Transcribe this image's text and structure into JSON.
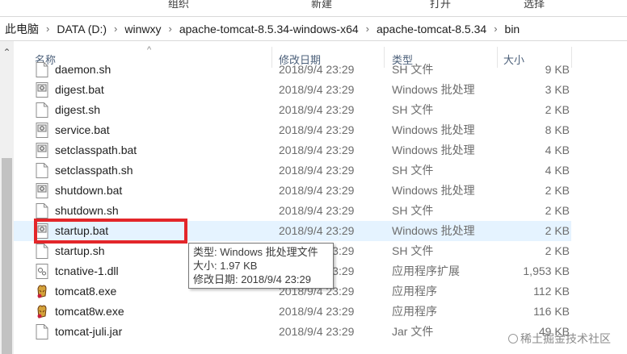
{
  "ribbon": {
    "group1": "组织",
    "group2": "新建",
    "group3": "打开",
    "group4": "选择"
  },
  "breadcrumb": [
    "此电脑",
    "DATA (D:)",
    "winwxy",
    "apache-tomcat-8.5.34-windows-x64",
    "apache-tomcat-8.5.34",
    "bin"
  ],
  "columns": {
    "name": "名称",
    "date": "修改日期",
    "type": "类型",
    "size": "大小"
  },
  "files": [
    {
      "name": "daemon.sh",
      "date": "2018/9/4 23:29",
      "type": "SH 文件",
      "size": "9 KB",
      "icon": "sh-file-icon"
    },
    {
      "name": "digest.bat",
      "date": "2018/9/4 23:29",
      "type": "Windows 批处理",
      "size": "3 KB",
      "icon": "bat-file-icon"
    },
    {
      "name": "digest.sh",
      "date": "2018/9/4 23:29",
      "type": "SH 文件",
      "size": "2 KB",
      "icon": "sh-file-icon"
    },
    {
      "name": "service.bat",
      "date": "2018/9/4 23:29",
      "type": "Windows 批处理",
      "size": "8 KB",
      "icon": "bat-file-icon"
    },
    {
      "name": "setclasspath.bat",
      "date": "2018/9/4 23:29",
      "type": "Windows 批处理",
      "size": "4 KB",
      "icon": "bat-file-icon"
    },
    {
      "name": "setclasspath.sh",
      "date": "2018/9/4 23:29",
      "type": "SH 文件",
      "size": "4 KB",
      "icon": "sh-file-icon"
    },
    {
      "name": "shutdown.bat",
      "date": "2018/9/4 23:29",
      "type": "Windows 批处理",
      "size": "2 KB",
      "icon": "bat-file-icon"
    },
    {
      "name": "shutdown.sh",
      "date": "2018/9/4 23:29",
      "type": "SH 文件",
      "size": "2 KB",
      "icon": "sh-file-icon"
    },
    {
      "name": "startup.bat",
      "date": "2018/9/4 23:29",
      "type": "Windows 批处理",
      "size": "2 KB",
      "icon": "bat-file-icon"
    },
    {
      "name": "startup.sh",
      "date": "2018/9/4 23:29",
      "type": "SH 文件",
      "size": "2 KB",
      "icon": "sh-file-icon"
    },
    {
      "name": "tcnative-1.dll",
      "date": "2018/9/4 23:29",
      "type": "应用程序扩展",
      "size": "1,953 KB",
      "icon": "dll-file-icon"
    },
    {
      "name": "tomcat8.exe",
      "date": "2018/9/4 23:29",
      "type": "应用程序",
      "size": "112 KB",
      "icon": "tomcat-exe-icon"
    },
    {
      "name": "tomcat8w.exe",
      "date": "2018/9/4 23:29",
      "type": "应用程序",
      "size": "116 KB",
      "icon": "tomcat-exe-icon"
    },
    {
      "name": "tomcat-juli.jar",
      "date": "2018/9/4 23:29",
      "type": "Jar 文件",
      "size": "49 KB",
      "icon": "jar-file-icon"
    }
  ],
  "tooltip": {
    "line1": "类型: Windows 批处理文件",
    "line2": "大小: 1.97 KB",
    "line3": "修改日期: 2018/9/4 23:29"
  },
  "watermark": "稀土掘金技术社区",
  "colors": {
    "highlight_border": "#e3262a",
    "hover_row": "#e5f3ff",
    "header_text": "#4c607a"
  }
}
